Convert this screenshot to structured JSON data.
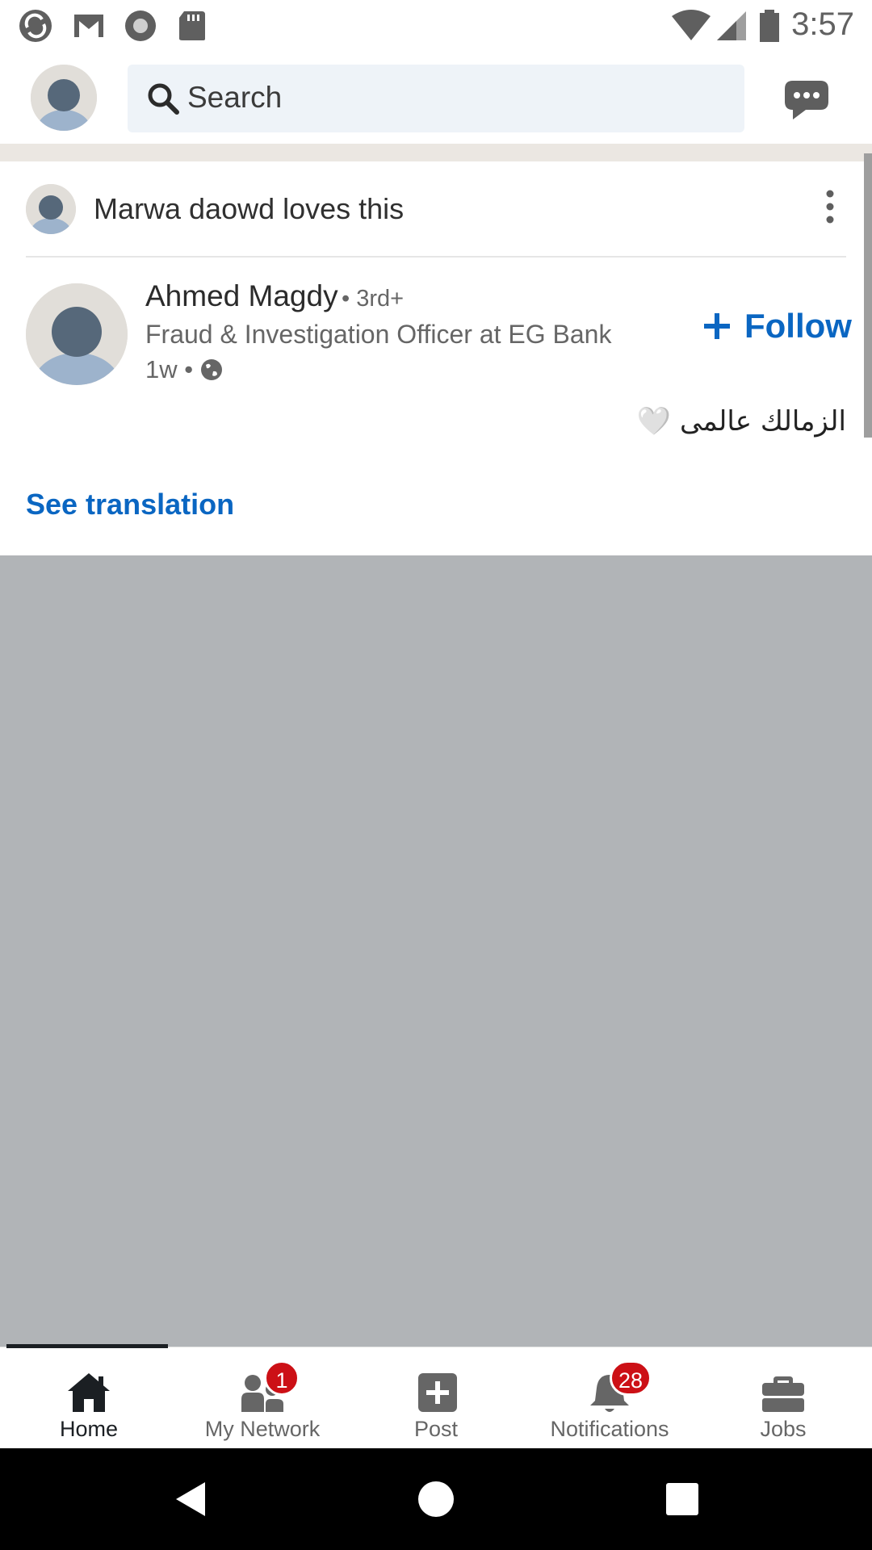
{
  "status_bar": {
    "time": "3:57",
    "left_icons": [
      "sync-icon",
      "gmail-icon",
      "record-icon",
      "sd-card-icon"
    ],
    "right_icons": [
      "wifi-icon",
      "signal-icon",
      "battery-icon"
    ]
  },
  "top_bar": {
    "search_placeholder": "Search",
    "icons": [
      "avatar",
      "search-icon",
      "messaging-icon"
    ]
  },
  "post": {
    "header_text": "Marwa daowd loves this",
    "author_name": "Ahmed Magdy",
    "author_degree": " • 3rd+",
    "author_headline": "Fraud & Investigation Officer at EG Bank",
    "time_ago": "1w •",
    "follow_label": "Follow",
    "body_text": "الزمالك عالمى 🤍",
    "see_translation_label": "See translation"
  },
  "bottom_nav": {
    "items": [
      {
        "label": "Home",
        "icon": "home-icon",
        "active": true
      },
      {
        "label": "My Network",
        "icon": "network-icon",
        "badge": "1"
      },
      {
        "label": "Post",
        "icon": "post-icon"
      },
      {
        "label": "Notifications",
        "icon": "bell-icon",
        "badge": "28"
      },
      {
        "label": "Jobs",
        "icon": "briefcase-icon"
      }
    ]
  },
  "colors": {
    "accent": "#0a66c2",
    "badge": "#cc1016",
    "media_placeholder": "#b1b4b7"
  }
}
